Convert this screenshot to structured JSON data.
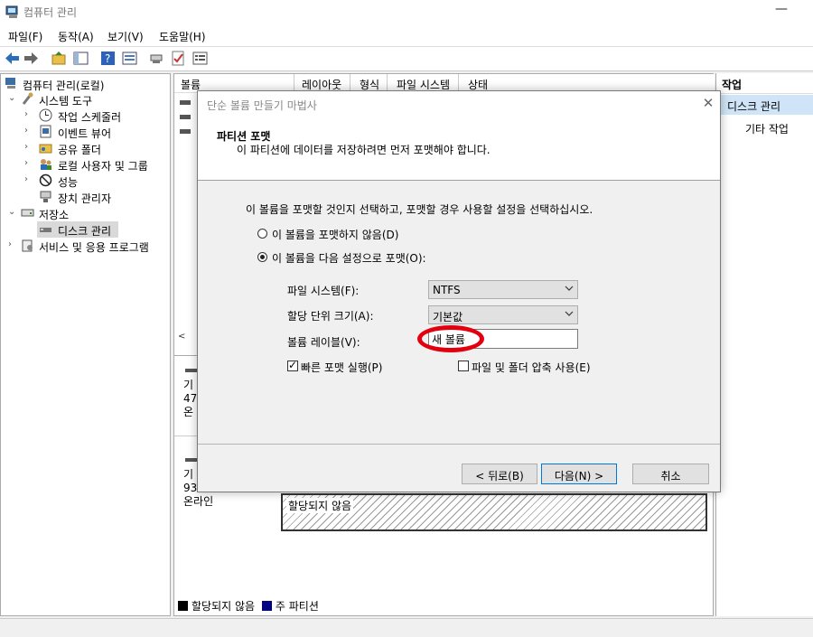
{
  "app": {
    "title": "컴퓨터 관리",
    "minimize_glyph": "—"
  },
  "menu": {
    "items": [
      "파일(F)",
      "동작(A)",
      "보기(V)",
      "도움말(H)"
    ]
  },
  "toolbar": {
    "icons": [
      "back-arrow-icon",
      "forward-arrow-icon",
      "up-folder-icon",
      "show-pane-icon",
      "help-icon",
      "properties-icon",
      "connect-icon",
      "check-icon",
      "list-icon"
    ]
  },
  "tree": {
    "root": "컴퓨터 관리(로컬)",
    "system_tools": "시스템 도구",
    "task_scheduler": "작업 스케줄러",
    "event_viewer": "이벤트 뷰어",
    "shared_folders": "공유 폴더",
    "local_users": "로컬 사용자 및 그룹",
    "performance": "성능",
    "device_manager": "장치 관리자",
    "storage": "저장소",
    "disk_management": "디스크 관리",
    "services": "서비스 및 응용 프로그램"
  },
  "columns": {
    "volume": "볼륨",
    "layout": "레이아웃",
    "type": "형식",
    "fs": "파일 시스템",
    "status": "상태"
  },
  "disks": {
    "disk0": {
      "line1": "기",
      "line2": "47",
      "line3": "온"
    },
    "disk1": {
      "line1": "기",
      "line2": "93",
      "line3": "온라인"
    },
    "unallocated": "할당되지 않음"
  },
  "legend": {
    "unallocated": "할당되지 않음",
    "primary": "주 파티션",
    "unallocated_color": "#000000",
    "primary_color": "#000080"
  },
  "actions": {
    "header": "작업",
    "selected": "디스크 관리",
    "other": "기타 작업"
  },
  "dialog": {
    "title": "단순 볼륨 만들기 마법사",
    "close": "✕",
    "header_title": "파티션 포맷",
    "header_sub": "이 파티션에 데이터를 저장하려면 먼저 포맷해야 합니다.",
    "instruction": "이 볼륨을 포맷할 것인지 선택하고, 포맷할 경우 사용할 설정을 선택하십시오.",
    "radio_noformat": "이 볼륨을 포맷하지 않음(D)",
    "radio_format": "이 볼륨을 다음 설정으로 포맷(O):",
    "fs_label": "파일 시스템(F):",
    "fs_value": "NTFS",
    "alloc_label": "할당 단위 크기(A):",
    "alloc_value": "기본값",
    "vol_label": "볼륨 레이블(V):",
    "vol_value": "새 볼륨",
    "quick_format": "빠른 포맷 실행(P)",
    "compress": "파일 및 폴더 압축 사용(E)",
    "back": "< 뒤로(B)",
    "next": "다음(N) >",
    "cancel": "취소",
    "highlight_color": "#e2000f"
  }
}
